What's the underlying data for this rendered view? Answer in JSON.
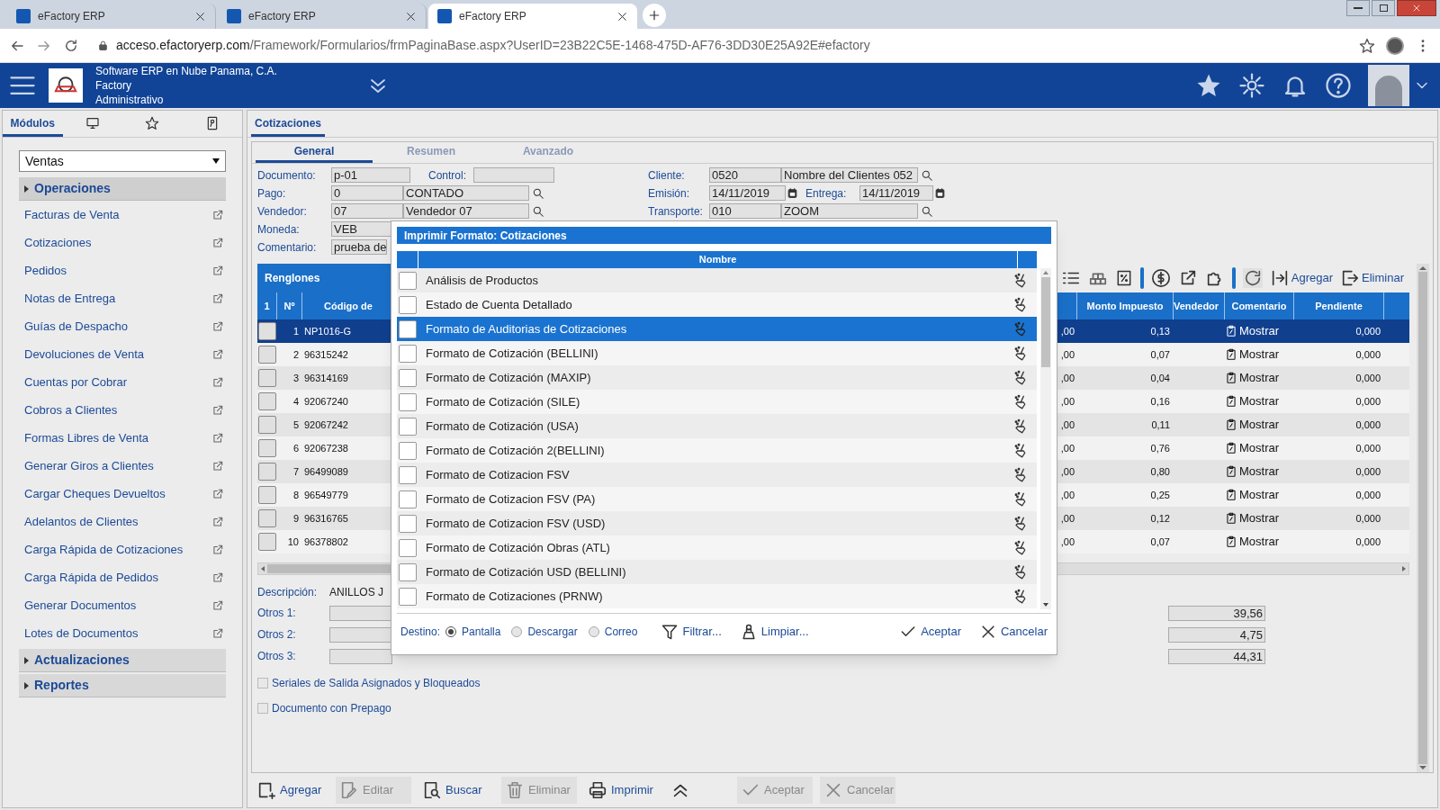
{
  "browser": {
    "tabs": [
      {
        "title": "eFactory ERP",
        "selected": false
      },
      {
        "title": "eFactory ERP",
        "selected": false
      },
      {
        "title": "eFactory ERP",
        "selected": true
      }
    ],
    "url_host": "acceso.efactoryerp.com",
    "url_path": "/Framework/Formularios/frmPaginaBase.aspx?UserID=23B22C5E-1468-475D-AF76-3DD30E25A92E#efactory"
  },
  "app_header": {
    "company_lines": [
      "Software ERP en Nube Panama, C.A.",
      "Factory",
      "Administrativo"
    ]
  },
  "sidebar": {
    "tabs": [
      {
        "kind": "label",
        "label": "Módulos",
        "selected": true
      },
      {
        "kind": "monitor",
        "selected": false
      },
      {
        "kind": "star",
        "selected": false
      },
      {
        "kind": "key",
        "selected": false
      }
    ],
    "module": "Ventas",
    "sections": [
      {
        "title": "Operaciones",
        "expanded": true,
        "items": [
          "Facturas de Venta",
          "Cotizaciones",
          "Pedidos",
          "Notas de Entrega",
          "Guías de Despacho",
          "Devoluciones de Venta",
          "Cuentas por Cobrar",
          "Cobros a Clientes",
          "Formas Libres de Venta",
          "Generar Giros a Clientes",
          "Cargar Cheques Devueltos",
          "Adelantos de Clientes",
          "Carga Rápida de Cotizaciones",
          "Carga Rápida de Pedidos",
          "Generar Documentos",
          "Lotes de Documentos"
        ]
      },
      {
        "title": "Actualizaciones",
        "expanded": false
      },
      {
        "title": "Reportes",
        "expanded": false
      }
    ]
  },
  "document_tab": "Cotizaciones",
  "subtabs": [
    {
      "label": "General",
      "selected": true
    },
    {
      "label": "Resumen",
      "selected": false
    },
    {
      "label": "Avanzado",
      "selected": false
    }
  ],
  "fields": {
    "documento": {
      "label": "Documento:",
      "value": "p-01"
    },
    "control": {
      "label": "Control:"
    },
    "pago": {
      "label": "Pago:",
      "code": "0",
      "name": "CONTADO"
    },
    "vendedor": {
      "label": "Vendedor:",
      "code": "07",
      "name": "Vendedor 07"
    },
    "moneda": {
      "label": "Moneda:",
      "value": "VEB"
    },
    "comentario": {
      "label": "Comentario:",
      "value": "prueba de"
    },
    "cliente": {
      "label": "Cliente:",
      "code": "0520",
      "name": "Nombre del Clientes 052"
    },
    "emision": {
      "label": "Emisión:",
      "value": "14/11/2019"
    },
    "entrega": {
      "label": "Entrega:",
      "value": "14/11/2019"
    },
    "transporte": {
      "label": "Transporte:",
      "code": "010",
      "name": "ZOOM"
    }
  },
  "lines": {
    "title": "Renglones",
    "toolbar_buttons": [
      "Agregar",
      "Eliminar"
    ],
    "columns": {
      "check": "1",
      "number": "Nº",
      "code": "Código de",
      "tax": "Monto Impuesto",
      "seller": "Vendedor",
      "comment": "Comentario",
      "pending": "Pendiente"
    },
    "rows": [
      {
        "number": "1",
        "code": "NP1016-G",
        "column_4": ",00",
        "tax": "0,13",
        "comment": "Mostrar",
        "pending": "0,000",
        "selected": true
      },
      {
        "number": "2",
        "code": "96315242",
        "column_4": ",00",
        "tax": "0,07",
        "comment": "Mostrar",
        "pending": "0,000",
        "selected": false
      },
      {
        "number": "3",
        "code": "96314169",
        "column_4": ",00",
        "tax": "0,04",
        "comment": "Mostrar",
        "pending": "0,000",
        "selected": false
      },
      {
        "number": "4",
        "code": "92067240",
        "column_4": ",00",
        "tax": "0,16",
        "comment": "Mostrar",
        "pending": "0,000",
        "selected": false
      },
      {
        "number": "5",
        "code": "92067242",
        "column_4": ",00",
        "tax": "0,11",
        "comment": "Mostrar",
        "pending": "0,000",
        "selected": false
      },
      {
        "number": "6",
        "code": "92067238",
        "column_4": ",00",
        "tax": "0,76",
        "comment": "Mostrar",
        "pending": "0,000",
        "selected": false
      },
      {
        "number": "7",
        "code": "96499089",
        "column_4": ",00",
        "tax": "0,80",
        "comment": "Mostrar",
        "pending": "0,000",
        "selected": false
      },
      {
        "number": "8",
        "code": "96549779",
        "column_4": ",00",
        "tax": "0,25",
        "comment": "Mostrar",
        "pending": "0,000",
        "selected": false
      },
      {
        "number": "9",
        "code": "96316765",
        "column_4": ",00",
        "tax": "0,12",
        "comment": "Mostrar",
        "pending": "0,000",
        "selected": false
      },
      {
        "number": "10",
        "code": "96378802",
        "column_4": ",00",
        "tax": "0,07",
        "comment": "Mostrar",
        "pending": "0,000",
        "selected": false
      }
    ]
  },
  "description": {
    "label": "Descripción:",
    "value": "ANILLOS J"
  },
  "others": [
    "Otros 1:",
    "Otros 2:",
    "Otros 3:"
  ],
  "totals": [
    "39,56",
    "4,75",
    "44,31"
  ],
  "options": [
    {
      "label": "Seriales de Salida Asignados y Bloqueados",
      "checked": false
    },
    {
      "label": "Documento con Prepago",
      "checked": false
    }
  ],
  "bottom_toolbar": [
    {
      "kind": "add",
      "label": "Agregar",
      "disabled": false
    },
    {
      "kind": "edit",
      "label": "Editar",
      "disabled": true
    },
    {
      "kind": "search",
      "label": "Buscar",
      "disabled": false
    },
    {
      "kind": "delete",
      "label": "Eliminar",
      "disabled": true
    },
    {
      "kind": "print",
      "label": "Imprimir",
      "disabled": false
    },
    {
      "kind": "collapse",
      "disabled": false
    },
    {
      "kind": "accept",
      "label": "Aceptar",
      "disabled": true
    },
    {
      "kind": "cancel",
      "label": "Cancelar",
      "disabled": true
    }
  ],
  "print_dialog": {
    "title": "Imprimir Formato: Cotizaciones",
    "column": "Nombre",
    "rows": [
      {
        "name": "Análisis de Productos",
        "selected": false,
        "checked": false
      },
      {
        "name": "Estado de Cuenta Detallado",
        "selected": false,
        "checked": false
      },
      {
        "name": "Formato de Auditorias de Cotizaciones",
        "selected": true,
        "checked": false
      },
      {
        "name": "Formato de Cotización (BELLINI)",
        "selected": false,
        "checked": false
      },
      {
        "name": "Formato de Cotización (MAXIP)",
        "selected": false,
        "checked": false
      },
      {
        "name": "Formato de Cotización (SILE)",
        "selected": false,
        "checked": false
      },
      {
        "name": "Formato de Cotización (USA)",
        "selected": false,
        "checked": false
      },
      {
        "name": "Formato de Cotización 2(BELLINI)",
        "selected": false,
        "checked": false
      },
      {
        "name": "Formato de Cotizacion FSV",
        "selected": false,
        "checked": false
      },
      {
        "name": "Formato de Cotizacion FSV (PA)",
        "selected": false,
        "checked": false
      },
      {
        "name": "Formato de Cotizacion FSV (USD)",
        "selected": false,
        "checked": false
      },
      {
        "name": "Formato de Cotización Obras (ATL)",
        "selected": false,
        "checked": false
      },
      {
        "name": "Formato de Cotización USD (BELLINI)",
        "selected": false,
        "checked": false
      },
      {
        "name": "Formato de Cotizaciones (PRNW)",
        "selected": false,
        "checked": false
      }
    ],
    "destination_label": "Destino:",
    "destinations": [
      {
        "label": "Pantalla",
        "selected": true
      },
      {
        "label": "Descargar",
        "selected": false
      },
      {
        "label": "Correo",
        "selected": false
      }
    ],
    "actions": [
      {
        "kind": "filter",
        "label": "Filtrar..."
      },
      {
        "kind": "clear",
        "label": "Limpiar..."
      },
      {
        "kind": "accept",
        "label": "Aceptar"
      },
      {
        "kind": "cancel",
        "label": "Cancelar"
      }
    ]
  }
}
